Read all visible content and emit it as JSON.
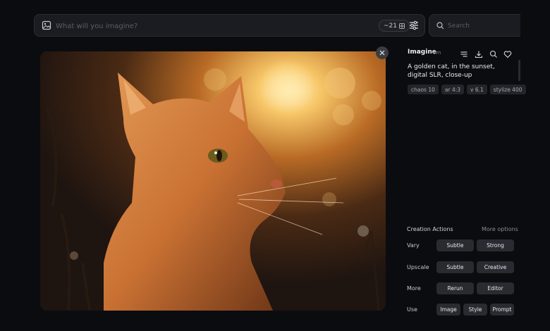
{
  "prompt_bar": {
    "placeholder": "What will you imagine?",
    "credits": "~21"
  },
  "search": {
    "placeholder": "Search"
  },
  "details": {
    "title": "Imagine",
    "time": "0m",
    "prompt": "A golden cat, in the sunset, digital SLR, close-up",
    "params": [
      "chaos 10",
      "ar 4:3",
      "v 6.1",
      "stylize 400"
    ]
  },
  "actions": {
    "title": "Creation Actions",
    "more_options": "More options",
    "rows": [
      {
        "label": "Vary",
        "buttons": [
          "Subtle",
          "Strong"
        ]
      },
      {
        "label": "Upscale",
        "buttons": [
          "Subtle",
          "Creative"
        ]
      },
      {
        "label": "More",
        "buttons": [
          "Rerun",
          "Editor"
        ]
      },
      {
        "label": "Use",
        "buttons": [
          "Image",
          "Style",
          "Prompt"
        ]
      }
    ]
  },
  "colors": {
    "background": "#0b0c0f",
    "panel": "#1b1c21",
    "button": "#2a2b31"
  }
}
